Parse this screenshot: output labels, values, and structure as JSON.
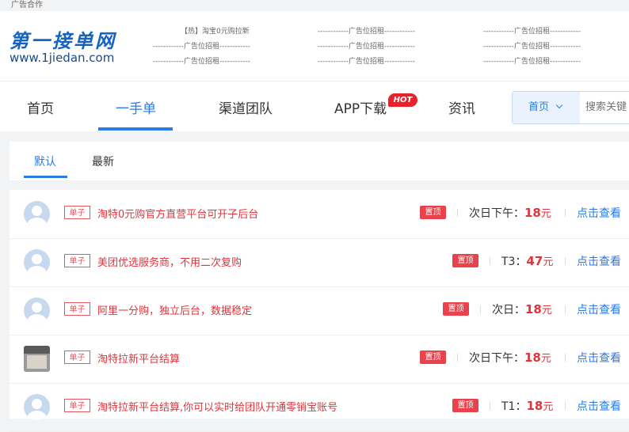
{
  "topbar": {
    "label": "广告合作"
  },
  "header": {
    "logo_title": "第一接单网",
    "logo_url": "www.1jiedan.com",
    "ads": [
      "【热】淘宝0元购拉新",
      "------------广告位招租------------",
      "------------广告位招租------------",
      "------------广告位招租------------",
      "------------广告位招租------------",
      "------------广告位招租------------",
      "------------广告位招租------------",
      "------------广告位招租------------",
      "------------广告位招租------------"
    ]
  },
  "nav": {
    "items": [
      "首页",
      "一手单",
      "渠道团队",
      "APP下载",
      "资讯"
    ],
    "active": "一手单",
    "hot_badge": "HOT",
    "search_select": "首页",
    "search_placeholder": "搜索关键"
  },
  "tabs": {
    "items": [
      "默认",
      "最新"
    ],
    "active": "默认"
  },
  "list": {
    "tag_label": "单子",
    "pin_label": "置顶",
    "view_label": "点击查看",
    "rows": [
      {
        "title": "淘特0元购官方直营平台可开子后台",
        "settle": "次日下午：",
        "amount": "18",
        "unit": "元",
        "avatar": "default"
      },
      {
        "title": "美团优选服务商，不用二次复购",
        "settle": "T3：",
        "amount": "47",
        "unit": "元",
        "avatar": "default"
      },
      {
        "title": "阿里一分购，独立后台，数据稳定",
        "settle": "次日：",
        "amount": "18",
        "unit": "元",
        "avatar": "default"
      },
      {
        "title": "淘特拉新平台结算",
        "settle": "次日下午：",
        "amount": "18",
        "unit": "元",
        "avatar": "photo"
      },
      {
        "title": "淘特拉新平台结算,你可以实时给团队开通零销宝账号",
        "settle": "T1：",
        "amount": "18",
        "unit": "元",
        "avatar": "default"
      }
    ]
  },
  "colors": {
    "accent": "#2a7be4",
    "hot": "#e8212a",
    "price": "#e0343c"
  }
}
